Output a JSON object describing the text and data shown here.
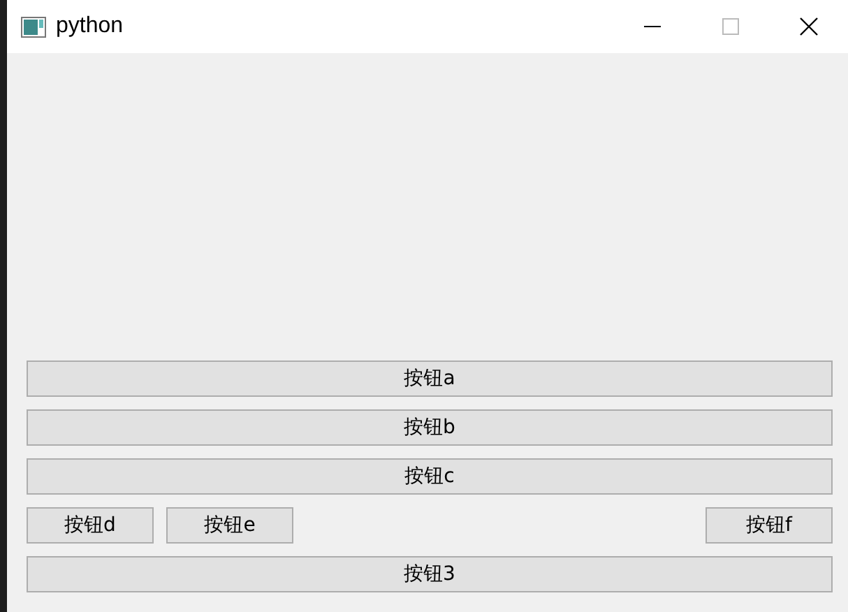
{
  "window": {
    "title": "python"
  },
  "rows": [
    {
      "kind": "full",
      "buttons": [
        {
          "label": "按钮a"
        }
      ]
    },
    {
      "kind": "full",
      "buttons": [
        {
          "label": "按钮b"
        }
      ]
    },
    {
      "kind": "full",
      "buttons": [
        {
          "label": "按钮c"
        }
      ]
    },
    {
      "kind": "split",
      "buttons": [
        {
          "label": "按钮d"
        },
        {
          "label": "按钮e"
        }
      ],
      "right_buttons": [
        {
          "label": "按钮f"
        }
      ]
    },
    {
      "kind": "full",
      "buttons": [
        {
          "label": "按钮3"
        }
      ]
    }
  ]
}
